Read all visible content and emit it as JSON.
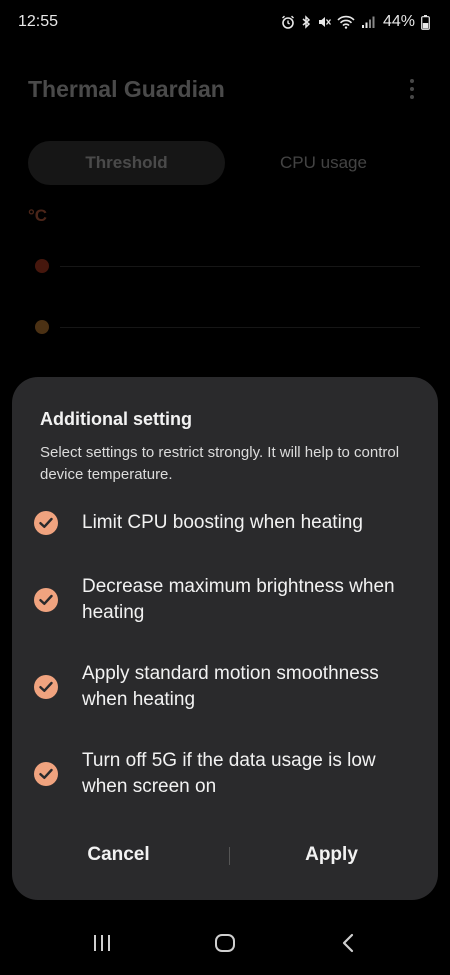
{
  "status_bar": {
    "time": "12:55",
    "battery": "44%"
  },
  "app": {
    "title": "Thermal Guardian",
    "tabs": [
      {
        "label": "Threshold",
        "active": true
      },
      {
        "label": "CPU usage",
        "active": false
      }
    ],
    "unit": "°C"
  },
  "dialog": {
    "title": "Additional setting",
    "description": "Select settings to restrict strongly. It will help to control device temperature.",
    "options": [
      {
        "label": "Limit CPU boosting when heating",
        "checked": true
      },
      {
        "label": "Decrease maximum brightness when heating",
        "checked": true
      },
      {
        "label": "Apply standard motion smoothness when heating",
        "checked": true
      },
      {
        "label": "Turn off 5G if the data usage is low when screen on",
        "checked": true
      }
    ],
    "cancel_label": "Cancel",
    "apply_label": "Apply"
  },
  "colors": {
    "accent": "#f0a37f",
    "dialog_bg": "#2a2a2c"
  }
}
